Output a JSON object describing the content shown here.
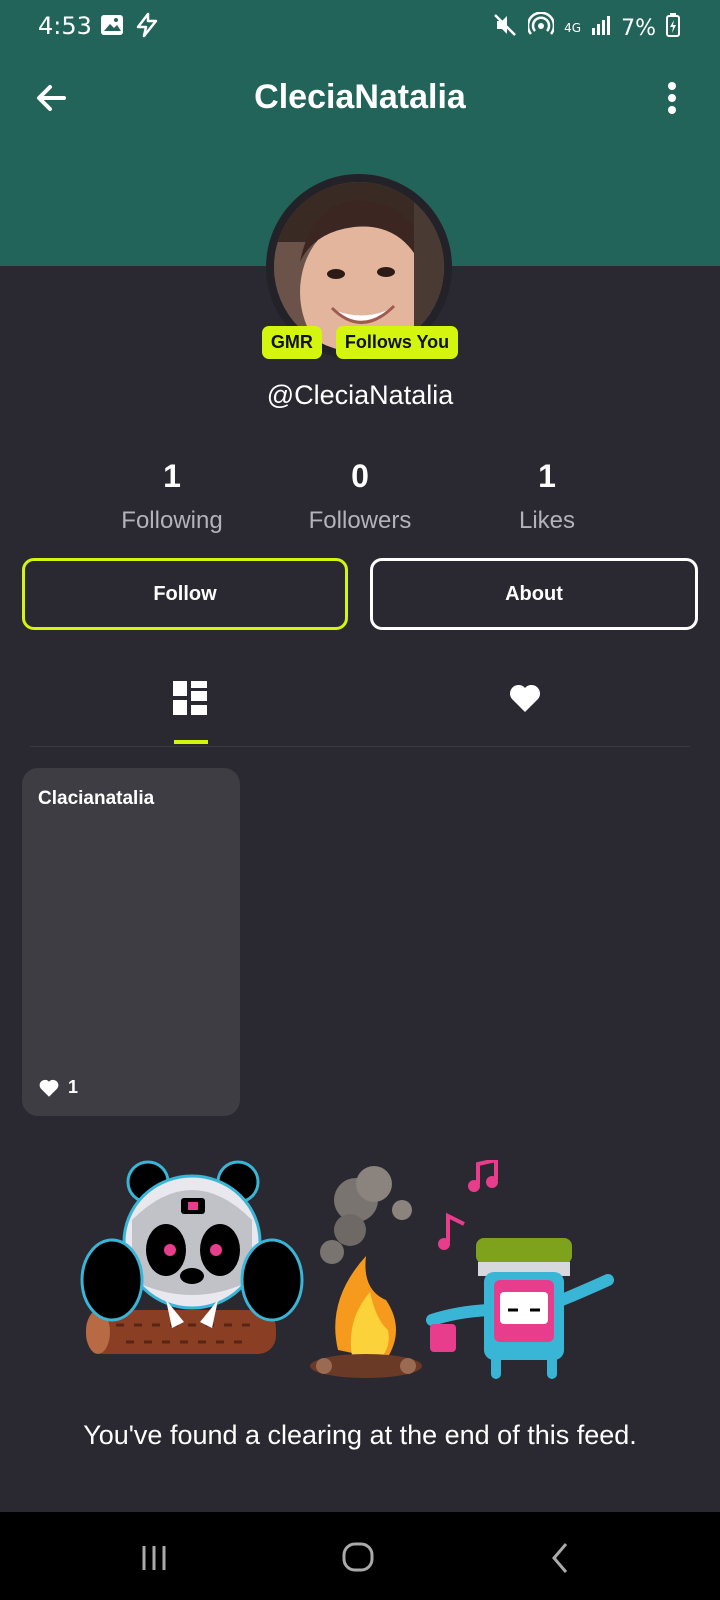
{
  "status_bar": {
    "time": "4:53",
    "network": "4G",
    "battery": "7%"
  },
  "app_bar": {
    "title": "CleciaNatalia"
  },
  "profile": {
    "badges": [
      "GMR",
      "Follows You"
    ],
    "handle": "@CleciaNatalia",
    "stats": [
      {
        "value": "1",
        "label": "Following"
      },
      {
        "value": "0",
        "label": "Followers"
      },
      {
        "value": "1",
        "label": "Likes"
      }
    ],
    "follow_label": "Follow",
    "about_label": "About"
  },
  "tabs": [
    {
      "icon": "grid-icon",
      "selected": true
    },
    {
      "icon": "heart-icon",
      "selected": false
    }
  ],
  "feed": [
    {
      "title": "Clacianatalia",
      "likes": "1"
    }
  ],
  "end_message": "You've found a clearing at the end of this feed.",
  "colors": {
    "header": "#23645a",
    "background": "#2a2830",
    "accent": "#d4f50d",
    "card": "#3e3d44"
  }
}
